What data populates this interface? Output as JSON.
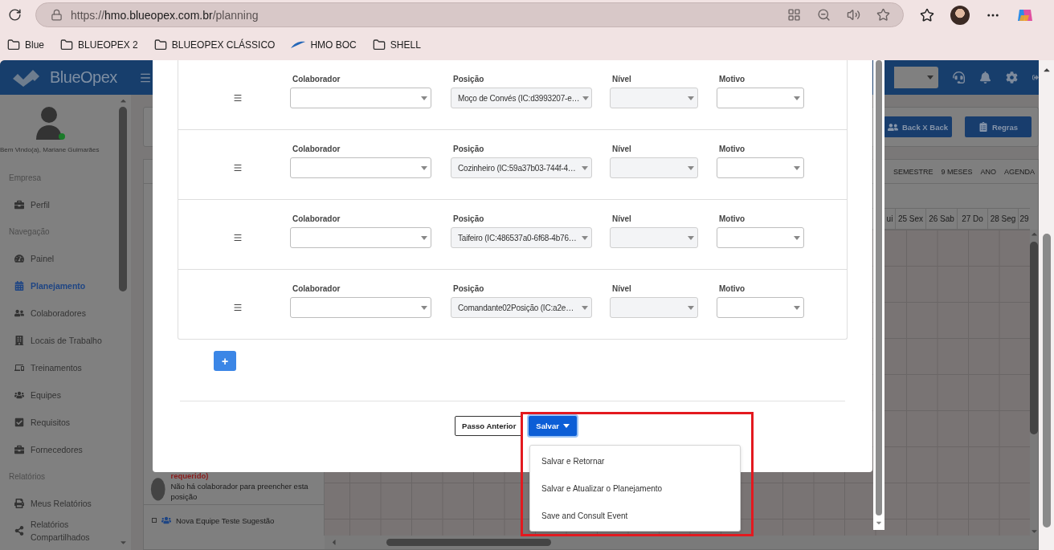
{
  "browser": {
    "url": {
      "scheme": "https://",
      "host": "hmo.blueopex.com.br",
      "path": "/planning"
    },
    "bookmarks": [
      {
        "label": "Blue",
        "kind": "folder"
      },
      {
        "label": "BLUEOPEX 2",
        "kind": "folder"
      },
      {
        "label": "BLUEOPEX CLÁSSICO",
        "kind": "folder"
      },
      {
        "label": "HMO BOC",
        "kind": "site"
      },
      {
        "label": "SHELL",
        "kind": "folder"
      }
    ]
  },
  "app": {
    "logo": "BlueOpex",
    "user": {
      "greeting": "Bem Vindo(a), Mariane Guimarães",
      "online": true
    },
    "sidebar": [
      {
        "title": "Empresa",
        "items": [
          {
            "label": "Perfil",
            "selected": false
          }
        ]
      },
      {
        "title": "Navegação",
        "items": [
          {
            "label": "Painel",
            "selected": false
          },
          {
            "label": "Planejamento",
            "selected": true
          },
          {
            "label": "Colaboradores",
            "selected": false
          },
          {
            "label": "Locais de Trabalho",
            "selected": false
          },
          {
            "label": "Treinamentos",
            "selected": false
          },
          {
            "label": "Equipes",
            "selected": false
          },
          {
            "label": "Requisitos",
            "selected": false
          },
          {
            "label": "Fornecedores",
            "selected": false
          }
        ]
      },
      {
        "title": "Relatórios",
        "items": [
          {
            "label": "Meus Relatórios",
            "selected": false
          },
          {
            "label": "Relatórios Compartilhados",
            "selected": false
          }
        ]
      }
    ]
  },
  "planning": {
    "actions": [
      "Back X Back",
      "Regras"
    ],
    "periods": [
      "SEMESTRE",
      "9 MESES",
      "ANO",
      "AGENDA"
    ],
    "days": [
      "ui",
      "25 Sex",
      "26 Sab",
      "27 Do",
      "28 Seg",
      "29"
    ],
    "rows": [
      {
        "kind": "vacancy",
        "status": "requerido)",
        "message": "Não há colaborador para preencher esta posição"
      },
      {
        "kind": "team",
        "name": "Nova Equipe Teste Sugestão"
      }
    ]
  },
  "modal": {
    "rows": [
      {
        "fields": [
          {
            "label": "Colaborador",
            "disabled": false
          },
          {
            "label": "Posição",
            "value": "Moço de Convés (IC:d3993207-e…",
            "disabled": true
          },
          {
            "label": "Nível",
            "disabled": true
          },
          {
            "label": "Motivo",
            "disabled": false
          }
        ]
      },
      {
        "fields": [
          {
            "label": "Colaborador",
            "disabled": false
          },
          {
            "label": "Posição",
            "value": "Cozinheiro (IC:59a37b03-744f-4…",
            "disabled": true
          },
          {
            "label": "Nível",
            "disabled": true
          },
          {
            "label": "Motivo",
            "disabled": false
          }
        ]
      },
      {
        "fields": [
          {
            "label": "Colaborador",
            "disabled": false
          },
          {
            "label": "Posição",
            "value": "Taifeiro (IC:486537a0-6f68-4b76…",
            "disabled": true
          },
          {
            "label": "Nível",
            "disabled": true
          },
          {
            "label": "Motivo",
            "disabled": false
          }
        ]
      },
      {
        "fields": [
          {
            "label": "Colaborador",
            "disabled": false
          },
          {
            "label": "Posição",
            "value": "Comandante02Posição (IC:a2e…",
            "disabled": true
          },
          {
            "label": "Nível",
            "disabled": true
          },
          {
            "label": "Motivo",
            "disabled": false
          }
        ]
      }
    ],
    "add_button": "+",
    "back_button": "Passo Anterior",
    "save_button": {
      "label": "Salvar",
      "expanded": true
    },
    "save_menu": [
      "Salvar e Retornar",
      "Salvar e Atualizar o Planejamento",
      "Save and Consult Event"
    ]
  }
}
